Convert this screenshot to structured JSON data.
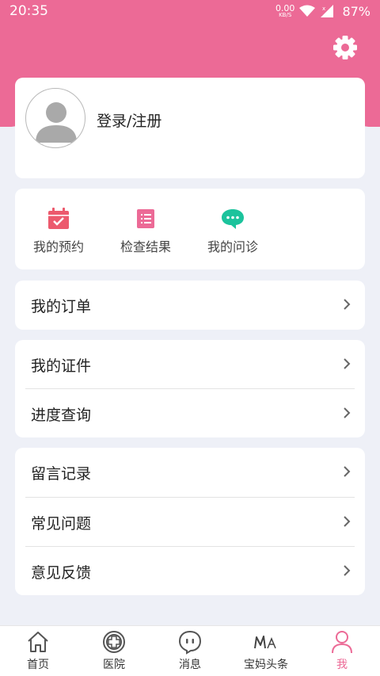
{
  "status_bar": {
    "time": "20:35",
    "net_speed_value": "0.00",
    "net_speed_unit": "KB/S",
    "battery": "87%",
    "icons": [
      "wifi-icon",
      "signal-icon"
    ]
  },
  "header": {
    "settings_icon": "gear-icon",
    "accent_color": "#ec6a96"
  },
  "profile": {
    "login_label": "登录/注册",
    "avatar_icon": "default-avatar-icon"
  },
  "quick_actions": [
    {
      "label": "我的预约",
      "icon": "calendar-check-icon",
      "color": "#ec5a6d"
    },
    {
      "label": "检查结果",
      "icon": "report-list-icon",
      "color": "#ec6a96"
    },
    {
      "label": "我的问诊",
      "icon": "chat-bubble-icon",
      "color": "#1bc39c"
    }
  ],
  "menu_groups": [
    {
      "items": [
        "我的订单"
      ]
    },
    {
      "items": [
        "我的证件",
        "进度查询"
      ]
    },
    {
      "items": [
        "留言记录",
        "常见问题",
        "意见反馈"
      ]
    }
  ],
  "tab_bar": {
    "tabs": [
      {
        "label": "首页",
        "icon": "home-icon"
      },
      {
        "label": "医院",
        "icon": "hospital-cross-icon"
      },
      {
        "label": "消息",
        "icon": "message-face-icon"
      },
      {
        "label": "宝妈头条",
        "icon": "mama-headline-icon"
      },
      {
        "label": "我",
        "icon": "person-icon"
      }
    ],
    "active_index": 4
  }
}
